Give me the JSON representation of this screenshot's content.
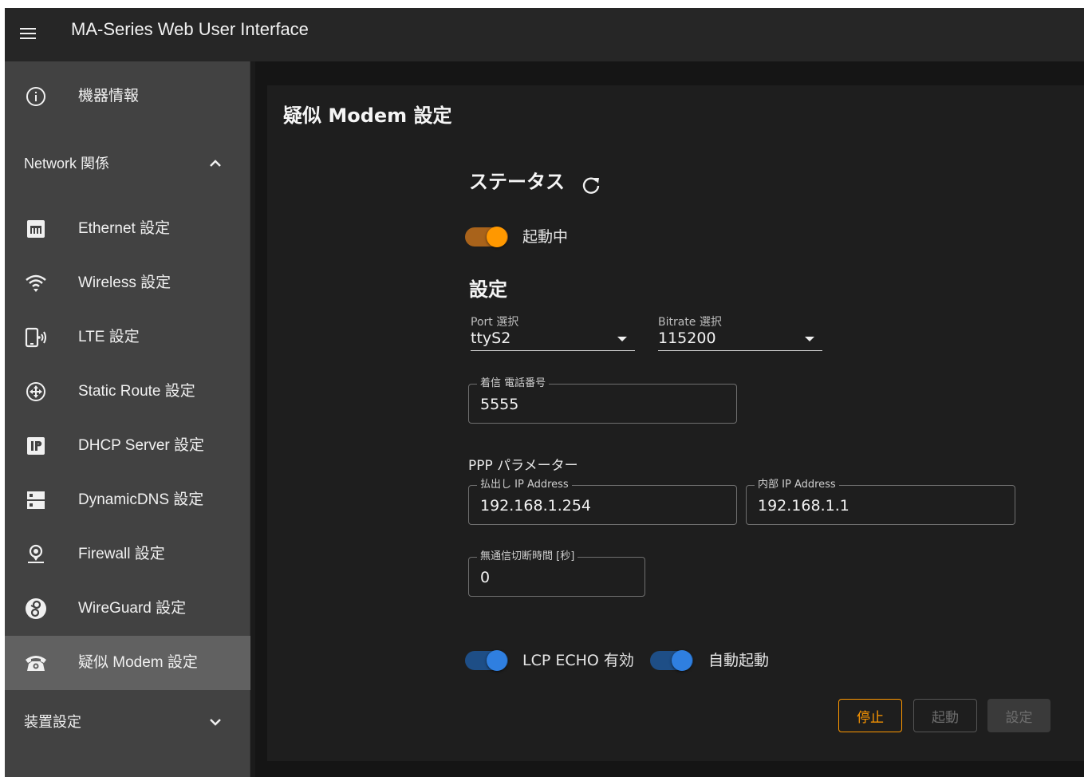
{
  "app": {
    "title": "MA-Series Web User Interface"
  },
  "sidebar": {
    "device_info": "機器情報",
    "network_group": "Network 関係",
    "items": [
      {
        "label": "Ethernet 設定",
        "icon": "ethernet-icon"
      },
      {
        "label": "Wireless 設定",
        "icon": "wifi-icon"
      },
      {
        "label": "LTE 設定",
        "icon": "lte-icon"
      },
      {
        "label": "Static Route 設定",
        "icon": "route-icon"
      },
      {
        "label": "DHCP Server 設定",
        "icon": "ip-icon"
      },
      {
        "label": "DynamicDNS 設定",
        "icon": "dns-icon"
      },
      {
        "label": "Firewall 設定",
        "icon": "firewall-icon"
      },
      {
        "label": "WireGuard 設定",
        "icon": "wireguard-icon"
      },
      {
        "label": "疑似 Modem 設定",
        "icon": "phone-icon",
        "active": true
      }
    ],
    "device_group": "装置設定"
  },
  "page": {
    "title": "疑似 Modem 設定",
    "status_title": "ステータス",
    "status_switch_label": "起動中",
    "settings_title": "設定",
    "port": {
      "label": "Port 選択",
      "value": "ttyS2"
    },
    "bitrate": {
      "label": "Bitrate 選択",
      "value": "115200"
    },
    "phone": {
      "label": "着信 電話番号",
      "value": "5555"
    },
    "ppp_title": "PPP パラメーター",
    "out_ip": {
      "label": "払出し IP Address",
      "value": "192.168.1.254"
    },
    "in_ip": {
      "label": "内部 IP Address",
      "value": "192.168.1.1"
    },
    "timeout": {
      "label": "無通信切断時間 [秒]",
      "value": "0"
    },
    "lcp_echo_label": "LCP ECHO 有効",
    "autostart_label": "自動起動",
    "buttons": {
      "stop": "停止",
      "start": "起動",
      "set": "設定"
    }
  },
  "colors": {
    "accent": "#ff9800",
    "switch_blue": "#2f7fe0",
    "sidebar_bg": "#424242",
    "active_bg": "#616161"
  }
}
